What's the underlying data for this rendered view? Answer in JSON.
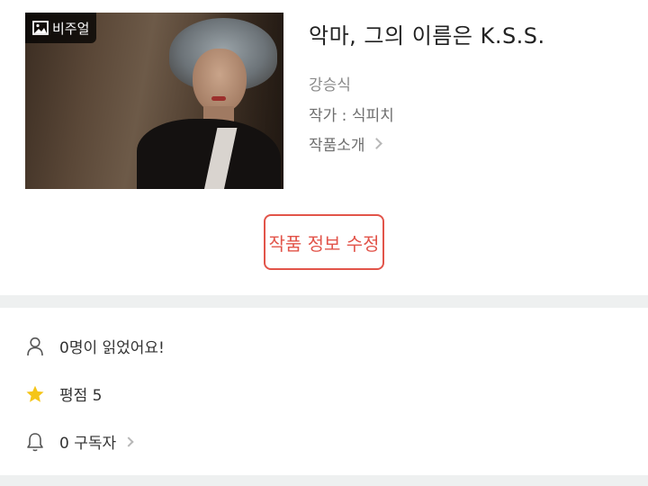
{
  "cover": {
    "badge_label": "비주얼",
    "badge_icon": "image-icon"
  },
  "work": {
    "title": "악마, 그의 이름은 K.S.S.",
    "author": "강승식",
    "writer_line": "작가 : 식피치",
    "intro_label": "작품소개"
  },
  "actions": {
    "edit_label": "작품 정보 수정"
  },
  "stats": [
    {
      "icon": "person-icon",
      "text": "0명이 읽었어요!"
    },
    {
      "icon": "star-icon",
      "text": "평점 5"
    },
    {
      "icon": "bell-icon",
      "text": "0 구독자"
    }
  ],
  "colors": {
    "accent": "#e2544a",
    "star": "#f5c518",
    "divider": "#eef0f0"
  }
}
